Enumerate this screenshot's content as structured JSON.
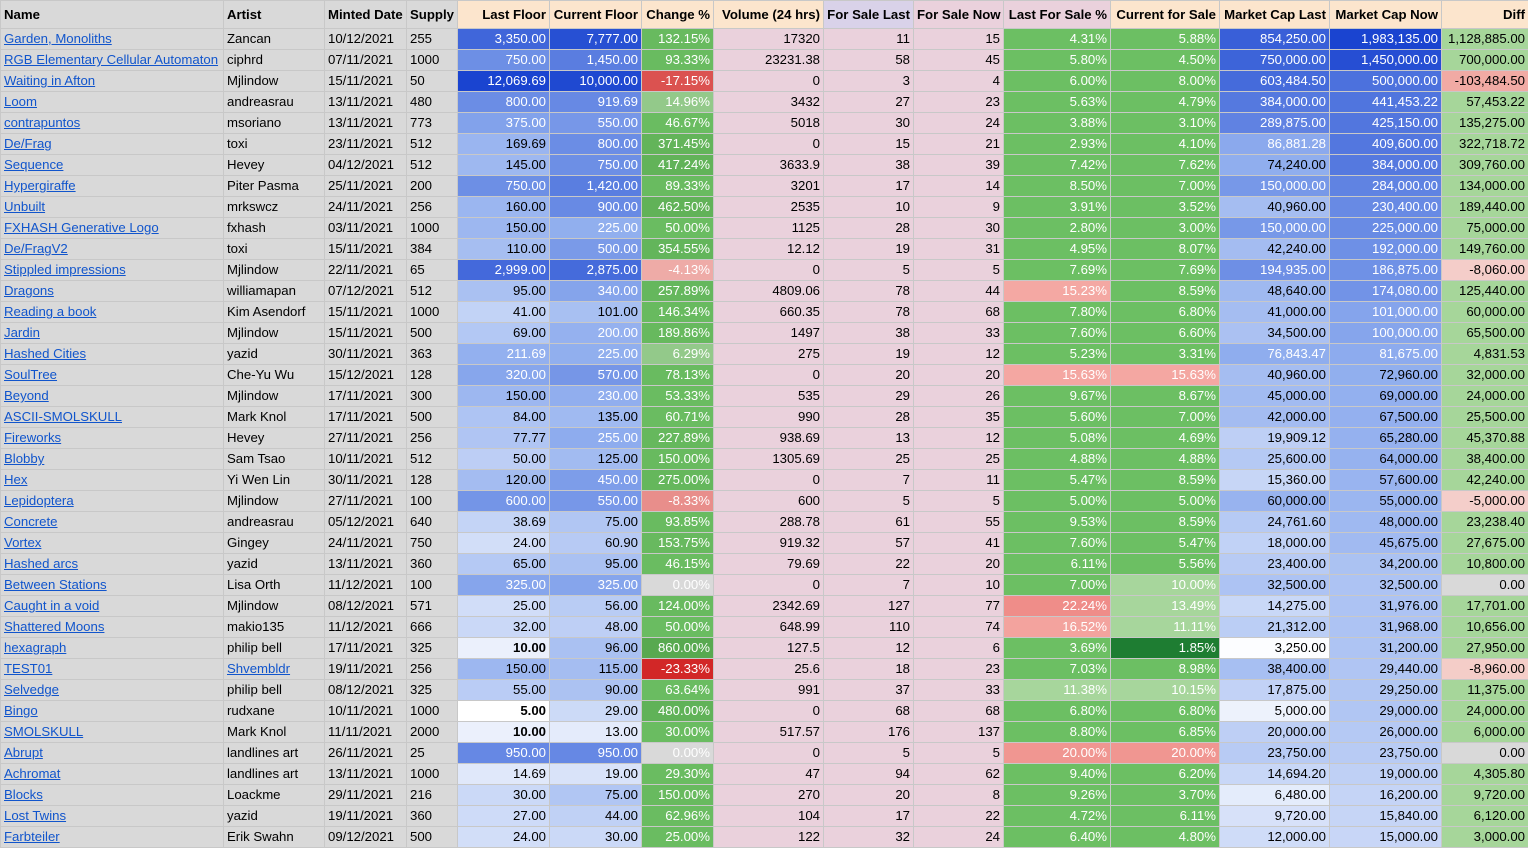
{
  "headers": [
    {
      "label": "Name",
      "cls": "h-gray",
      "align": "left",
      "name": "header-name"
    },
    {
      "label": "Artist",
      "cls": "h-gray",
      "align": "left",
      "name": "header-artist"
    },
    {
      "label": "Minted Date",
      "cls": "h-gray",
      "align": "left",
      "name": "header-minted-date"
    },
    {
      "label": "Supply",
      "cls": "h-gray",
      "align": "left",
      "name": "header-supply"
    },
    {
      "label": "Last Floor",
      "cls": "h-orange",
      "align": "right",
      "name": "header-last-floor"
    },
    {
      "label": "Current Floor",
      "cls": "h-orange",
      "align": "right",
      "name": "header-current-floor"
    },
    {
      "label": "Change %",
      "cls": "h-orange",
      "align": "right",
      "name": "header-change-pct"
    },
    {
      "label": "Volume (24 hrs)",
      "cls": "h-orange",
      "align": "right",
      "name": "header-volume"
    },
    {
      "label": "For Sale Last",
      "cls": "h-purple",
      "align": "right",
      "name": "header-for-sale-last"
    },
    {
      "label": "For Sale Now",
      "cls": "h-pink",
      "align": "right",
      "name": "header-for-sale-now"
    },
    {
      "label": "Last For Sale %",
      "cls": "h-pink",
      "align": "right",
      "name": "header-last-for-sale-pct"
    },
    {
      "label": "Current for Sale",
      "cls": "h-orange",
      "align": "right",
      "name": "header-current-for-sale"
    },
    {
      "label": "Market Cap Last",
      "cls": "h-orange",
      "align": "right",
      "name": "header-market-cap-last"
    },
    {
      "label": "Market Cap Now",
      "cls": "h-orange",
      "align": "right",
      "name": "header-market-cap-now"
    },
    {
      "label": "Diff",
      "cls": "h-orange",
      "align": "right",
      "name": "header-diff"
    }
  ],
  "colors": {
    "blue_dark": "#1c4fd6",
    "blue_mid": "#5b84e6",
    "blue_light": "#a8c0f2",
    "blue_pale": "#cfdcf8",
    "green_dark": "#1e7d32",
    "green_mid": "#57bb60",
    "green_light": "#a7d69c",
    "red_dark": "#d01c1c",
    "red_light": "#f4c7c3",
    "red_mid": "#ee8f8b",
    "pink": "#ead1dc",
    "gray": "#d9d9d9",
    "white": "#ffffff"
  },
  "rows": [
    {
      "name": "Garden, Monoliths",
      "artist": "Zancan",
      "minted": "10/12/2021",
      "supply": "255",
      "last_floor": "3,350.00",
      "current_floor": "7,777.00",
      "change": "132.15%",
      "volume": "17320",
      "fs_last": "11",
      "fs_now": "15",
      "last_fs_pct": "4.31%",
      "cur_fs": "5.88%",
      "mc_last": "854,250.00",
      "mc_now": "1,983,135.00",
      "diff": "1,128,885.00"
    },
    {
      "name": "RGB Elementary Cellular Automaton",
      "artist": "ciphrd",
      "minted": "07/11/2021",
      "supply": "1000",
      "last_floor": "750.00",
      "current_floor": "1,450.00",
      "change": "93.33%",
      "volume": "23231.38",
      "fs_last": "58",
      "fs_now": "45",
      "last_fs_pct": "5.80%",
      "cur_fs": "4.50%",
      "mc_last": "750,000.00",
      "mc_now": "1,450,000.00",
      "diff": "700,000.00"
    },
    {
      "name": "Waiting in Afton",
      "artist": "Mjlindow",
      "minted": "15/11/2021",
      "supply": "50",
      "last_floor": "12,069.69",
      "current_floor": "10,000.00",
      "change": "-17.15%",
      "volume": "0",
      "fs_last": "3",
      "fs_now": "4",
      "last_fs_pct": "6.00%",
      "cur_fs": "8.00%",
      "mc_last": "603,484.50",
      "mc_now": "500,000.00",
      "diff": "-103,484.50"
    },
    {
      "name": "Loom",
      "artist": "andreasrau",
      "minted": "13/11/2021",
      "supply": "480",
      "last_floor": "800.00",
      "current_floor": "919.69",
      "change": "14.96%",
      "volume": "3432",
      "fs_last": "27",
      "fs_now": "23",
      "last_fs_pct": "5.63%",
      "cur_fs": "4.79%",
      "mc_last": "384,000.00",
      "mc_now": "441,453.22",
      "diff": "57,453.22"
    },
    {
      "name": "contrapuntos",
      "artist": "msoriano",
      "minted": "13/11/2021",
      "supply": "773",
      "last_floor": "375.00",
      "current_floor": "550.00",
      "change": "46.67%",
      "volume": "5018",
      "fs_last": "30",
      "fs_now": "24",
      "last_fs_pct": "3.88%",
      "cur_fs": "3.10%",
      "mc_last": "289,875.00",
      "mc_now": "425,150.00",
      "diff": "135,275.00"
    },
    {
      "name": "De/Frag",
      "artist": "toxi",
      "minted": "23/11/2021",
      "supply": "512",
      "last_floor": "169.69",
      "current_floor": "800.00",
      "change": "371.45%",
      "volume": "0",
      "fs_last": "15",
      "fs_now": "21",
      "last_fs_pct": "2.93%",
      "cur_fs": "4.10%",
      "mc_last": "86,881.28",
      "mc_now": "409,600.00",
      "diff": "322,718.72"
    },
    {
      "name": "Sequence",
      "artist": "Hevey",
      "minted": "04/12/2021",
      "supply": "512",
      "last_floor": "145.00",
      "current_floor": "750.00",
      "change": "417.24%",
      "volume": "3633.9",
      "fs_last": "38",
      "fs_now": "39",
      "last_fs_pct": "7.42%",
      "cur_fs": "7.62%",
      "mc_last": "74,240.00",
      "mc_now": "384,000.00",
      "diff": "309,760.00"
    },
    {
      "name": "Hypergiraffe",
      "artist": "Piter Pasma",
      "minted": "25/11/2021",
      "supply": "200",
      "last_floor": "750.00",
      "current_floor": "1,420.00",
      "change": "89.33%",
      "volume": "3201",
      "fs_last": "17",
      "fs_now": "14",
      "last_fs_pct": "8.50%",
      "cur_fs": "7.00%",
      "mc_last": "150,000.00",
      "mc_now": "284,000.00",
      "diff": "134,000.00"
    },
    {
      "name": "Unbuilt",
      "artist": "mrkswcz",
      "minted": "24/11/2021",
      "supply": "256",
      "last_floor": "160.00",
      "current_floor": "900.00",
      "change": "462.50%",
      "volume": "2535",
      "fs_last": "10",
      "fs_now": "9",
      "last_fs_pct": "3.91%",
      "cur_fs": "3.52%",
      "mc_last": "40,960.00",
      "mc_now": "230,400.00",
      "diff": "189,440.00"
    },
    {
      "name": "FXHASH Generative Logo",
      "artist": "fxhash",
      "minted": "03/11/2021",
      "supply": "1000",
      "last_floor": "150.00",
      "current_floor": "225.00",
      "change": "50.00%",
      "volume": "1125",
      "fs_last": "28",
      "fs_now": "30",
      "last_fs_pct": "2.80%",
      "cur_fs": "3.00%",
      "mc_last": "150,000.00",
      "mc_now": "225,000.00",
      "diff": "75,000.00"
    },
    {
      "name": "De/FragV2",
      "artist": "toxi",
      "minted": "15/11/2021",
      "supply": "384",
      "last_floor": "110.00",
      "current_floor": "500.00",
      "change": "354.55%",
      "volume": "12.12",
      "fs_last": "19",
      "fs_now": "31",
      "last_fs_pct": "4.95%",
      "cur_fs": "8.07%",
      "mc_last": "42,240.00",
      "mc_now": "192,000.00",
      "diff": "149,760.00"
    },
    {
      "name": "Stippled impressions",
      "artist": "Mjlindow",
      "minted": "22/11/2021",
      "supply": "65",
      "last_floor": "2,999.00",
      "current_floor": "2,875.00",
      "change": "-4.13%",
      "volume": "0",
      "fs_last": "5",
      "fs_now": "5",
      "last_fs_pct": "7.69%",
      "cur_fs": "7.69%",
      "mc_last": "194,935.00",
      "mc_now": "186,875.00",
      "diff": "-8,060.00"
    },
    {
      "name": "Dragons",
      "artist": "williamapan",
      "minted": "07/12/2021",
      "supply": "512",
      "last_floor": "95.00",
      "current_floor": "340.00",
      "change": "257.89%",
      "volume": "4809.06",
      "fs_last": "78",
      "fs_now": "44",
      "last_fs_pct": "15.23%",
      "cur_fs": "8.59%",
      "mc_last": "48,640.00",
      "mc_now": "174,080.00",
      "diff": "125,440.00"
    },
    {
      "name": "Reading a book",
      "artist": "Kim Asendorf",
      "minted": "15/11/2021",
      "supply": "1000",
      "last_floor": "41.00",
      "current_floor": "101.00",
      "change": "146.34%",
      "volume": "660.35",
      "fs_last": "78",
      "fs_now": "68",
      "last_fs_pct": "7.80%",
      "cur_fs": "6.80%",
      "mc_last": "41,000.00",
      "mc_now": "101,000.00",
      "diff": "60,000.00"
    },
    {
      "name": "Jardin",
      "artist": "Mjlindow",
      "minted": "15/11/2021",
      "supply": "500",
      "last_floor": "69.00",
      "current_floor": "200.00",
      "change": "189.86%",
      "volume": "1497",
      "fs_last": "38",
      "fs_now": "33",
      "last_fs_pct": "7.60%",
      "cur_fs": "6.60%",
      "mc_last": "34,500.00",
      "mc_now": "100,000.00",
      "diff": "65,500.00"
    },
    {
      "name": "Hashed Cities",
      "artist": "yazid",
      "minted": "30/11/2021",
      "supply": "363",
      "last_floor": "211.69",
      "current_floor": "225.00",
      "change": "6.29%",
      "volume": "275",
      "fs_last": "19",
      "fs_now": "12",
      "last_fs_pct": "5.23%",
      "cur_fs": "3.31%",
      "mc_last": "76,843.47",
      "mc_now": "81,675.00",
      "diff": "4,831.53"
    },
    {
      "name": "SoulTree",
      "artist": "Che-Yu Wu",
      "minted": "15/12/2021",
      "supply": "128",
      "last_floor": "320.00",
      "current_floor": "570.00",
      "change": "78.13%",
      "volume": "0",
      "fs_last": "20",
      "fs_now": "20",
      "last_fs_pct": "15.63%",
      "cur_fs": "15.63%",
      "mc_last": "40,960.00",
      "mc_now": "72,960.00",
      "diff": "32,000.00"
    },
    {
      "name": "Beyond",
      "artist": "Mjlindow",
      "minted": "17/11/2021",
      "supply": "300",
      "last_floor": "150.00",
      "current_floor": "230.00",
      "change": "53.33%",
      "volume": "535",
      "fs_last": "29",
      "fs_now": "26",
      "last_fs_pct": "9.67%",
      "cur_fs": "8.67%",
      "mc_last": "45,000.00",
      "mc_now": "69,000.00",
      "diff": "24,000.00"
    },
    {
      "name": "ASCII-SMOLSKULL",
      "artist": "Mark Knol",
      "minted": "17/11/2021",
      "supply": "500",
      "last_floor": "84.00",
      "current_floor": "135.00",
      "change": "60.71%",
      "volume": "990",
      "fs_last": "28",
      "fs_now": "35",
      "last_fs_pct": "5.60%",
      "cur_fs": "7.00%",
      "mc_last": "42,000.00",
      "mc_now": "67,500.00",
      "diff": "25,500.00"
    },
    {
      "name": "Fireworks",
      "artist": "Hevey",
      "minted": "27/11/2021",
      "supply": "256",
      "last_floor": "77.77",
      "current_floor": "255.00",
      "change": "227.89%",
      "volume": "938.69",
      "fs_last": "13",
      "fs_now": "12",
      "last_fs_pct": "5.08%",
      "cur_fs": "4.69%",
      "mc_last": "19,909.12",
      "mc_now": "65,280.00",
      "diff": "45,370.88"
    },
    {
      "name": "Blobby",
      "artist": "Sam Tsao",
      "minted": "10/11/2021",
      "supply": "512",
      "last_floor": "50.00",
      "current_floor": "125.00",
      "change": "150.00%",
      "volume": "1305.69",
      "fs_last": "25",
      "fs_now": "25",
      "last_fs_pct": "4.88%",
      "cur_fs": "4.88%",
      "mc_last": "25,600.00",
      "mc_now": "64,000.00",
      "diff": "38,400.00"
    },
    {
      "name": "Hex",
      "artist": "Yi Wen Lin",
      "minted": "30/11/2021",
      "supply": "128",
      "last_floor": "120.00",
      "current_floor": "450.00",
      "change": "275.00%",
      "volume": "0",
      "fs_last": "7",
      "fs_now": "11",
      "last_fs_pct": "5.47%",
      "cur_fs": "8.59%",
      "mc_last": "15,360.00",
      "mc_now": "57,600.00",
      "diff": "42,240.00"
    },
    {
      "name": "Lepidoptera",
      "artist": "Mjlindow",
      "minted": "27/11/2021",
      "supply": "100",
      "last_floor": "600.00",
      "current_floor": "550.00",
      "change": "-8.33%",
      "volume": "600",
      "fs_last": "5",
      "fs_now": "5",
      "last_fs_pct": "5.00%",
      "cur_fs": "5.00%",
      "mc_last": "60,000.00",
      "mc_now": "55,000.00",
      "diff": "-5,000.00"
    },
    {
      "name": "Concrete",
      "artist": "andreasrau",
      "minted": "05/12/2021",
      "supply": "640",
      "last_floor": "38.69",
      "current_floor": "75.00",
      "change": "93.85%",
      "volume": "288.78",
      "fs_last": "61",
      "fs_now": "55",
      "last_fs_pct": "9.53%",
      "cur_fs": "8.59%",
      "mc_last": "24,761.60",
      "mc_now": "48,000.00",
      "diff": "23,238.40"
    },
    {
      "name": "Vortex",
      "artist": "Gingey",
      "minted": "24/11/2021",
      "supply": "750",
      "last_floor": "24.00",
      "current_floor": "60.90",
      "change": "153.75%",
      "volume": "919.32",
      "fs_last": "57",
      "fs_now": "41",
      "last_fs_pct": "7.60%",
      "cur_fs": "5.47%",
      "mc_last": "18,000.00",
      "mc_now": "45,675.00",
      "diff": "27,675.00"
    },
    {
      "name": "Hashed arcs",
      "artist": "yazid",
      "minted": "13/11/2021",
      "supply": "360",
      "last_floor": "65.00",
      "current_floor": "95.00",
      "change": "46.15%",
      "volume": "79.69",
      "fs_last": "22",
      "fs_now": "20",
      "last_fs_pct": "6.11%",
      "cur_fs": "5.56%",
      "mc_last": "23,400.00",
      "mc_now": "34,200.00",
      "diff": "10,800.00"
    },
    {
      "name": "Between Stations",
      "artist": "Lisa Orth",
      "minted": "11/12/2021",
      "supply": "100",
      "last_floor": "325.00",
      "current_floor": "325.00",
      "change": "0.00%",
      "volume": "0",
      "fs_last": "7",
      "fs_now": "10",
      "last_fs_pct": "7.00%",
      "cur_fs": "10.00%",
      "mc_last": "32,500.00",
      "mc_now": "32,500.00",
      "diff": "0.00"
    },
    {
      "name": "Caught in a void",
      "artist": "Mjlindow",
      "minted": "08/12/2021",
      "supply": "571",
      "last_floor": "25.00",
      "current_floor": "56.00",
      "change": "124.00%",
      "volume": "2342.69",
      "fs_last": "127",
      "fs_now": "77",
      "last_fs_pct": "22.24%",
      "cur_fs": "13.49%",
      "mc_last": "14,275.00",
      "mc_now": "31,976.00",
      "diff": "17,701.00"
    },
    {
      "name": "Shattered Moons",
      "artist": "makio135",
      "minted": "11/12/2021",
      "supply": "666",
      "last_floor": "32.00",
      "current_floor": "48.00",
      "change": "50.00%",
      "volume": "648.99",
      "fs_last": "110",
      "fs_now": "74",
      "last_fs_pct": "16.52%",
      "cur_fs": "11.11%",
      "mc_last": "21,312.00",
      "mc_now": "31,968.00",
      "diff": "10,656.00"
    },
    {
      "name": "hexagraph",
      "artist": "philip bell",
      "minted": "17/11/2021",
      "supply": "325",
      "last_floor": "10.00",
      "current_floor": "96.00",
      "change": "860.00%",
      "volume": "127.5",
      "fs_last": "12",
      "fs_now": "6",
      "last_fs_pct": "3.69%",
      "cur_fs": "1.85%",
      "mc_last": "3,250.00",
      "mc_now": "31,200.00",
      "diff": "27,950.00"
    },
    {
      "name": "TEST01",
      "artist": "Shvembldr",
      "minted": "19/11/2021",
      "supply": "256",
      "last_floor": "150.00",
      "current_floor": "115.00",
      "change": "-23.33%",
      "volume": "25.6",
      "fs_last": "18",
      "fs_now": "23",
      "last_fs_pct": "7.03%",
      "cur_fs": "8.98%",
      "mc_last": "38,400.00",
      "mc_now": "29,440.00",
      "diff": "-8,960.00"
    },
    {
      "name": "Selvedge",
      "artist": "philip bell",
      "minted": "08/12/2021",
      "supply": "325",
      "last_floor": "55.00",
      "current_floor": "90.00",
      "change": "63.64%",
      "volume": "991",
      "fs_last": "37",
      "fs_now": "33",
      "last_fs_pct": "11.38%",
      "cur_fs": "10.15%",
      "mc_last": "17,875.00",
      "mc_now": "29,250.00",
      "diff": "11,375.00"
    },
    {
      "name": "Bingo",
      "artist": "rudxane",
      "minted": "10/11/2021",
      "supply": "1000",
      "last_floor": "5.00",
      "current_floor": "29.00",
      "change": "480.00%",
      "volume": "0",
      "fs_last": "68",
      "fs_now": "68",
      "last_fs_pct": "6.80%",
      "cur_fs": "6.80%",
      "mc_last": "5,000.00",
      "mc_now": "29,000.00",
      "diff": "24,000.00"
    },
    {
      "name": "SMOLSKULL",
      "artist": "Mark Knol",
      "minted": "11/11/2021",
      "supply": "2000",
      "last_floor": "10.00",
      "current_floor": "13.00",
      "change": "30.00%",
      "volume": "517.57",
      "fs_last": "176",
      "fs_now": "137",
      "last_fs_pct": "8.80%",
      "cur_fs": "6.85%",
      "mc_last": "20,000.00",
      "mc_now": "26,000.00",
      "diff": "6,000.00"
    },
    {
      "name": "Abrupt",
      "artist": "landlines art",
      "minted": "26/11/2021",
      "supply": "25",
      "last_floor": "950.00",
      "current_floor": "950.00",
      "change": "0.00%",
      "volume": "0",
      "fs_last": "5",
      "fs_now": "5",
      "last_fs_pct": "20.00%",
      "cur_fs": "20.00%",
      "mc_last": "23,750.00",
      "mc_now": "23,750.00",
      "diff": "0.00"
    },
    {
      "name": "Achromat",
      "artist": "landlines art",
      "minted": "13/11/2021",
      "supply": "1000",
      "last_floor": "14.69",
      "current_floor": "19.00",
      "change": "29.30%",
      "volume": "47",
      "fs_last": "94",
      "fs_now": "62",
      "last_fs_pct": "9.40%",
      "cur_fs": "6.20%",
      "mc_last": "14,694.20",
      "mc_now": "19,000.00",
      "diff": "4,305.80"
    },
    {
      "name": "Blocks",
      "artist": "Loackme",
      "minted": "29/11/2021",
      "supply": "216",
      "last_floor": "30.00",
      "current_floor": "75.00",
      "change": "150.00%",
      "volume": "270",
      "fs_last": "20",
      "fs_now": "8",
      "last_fs_pct": "9.26%",
      "cur_fs": "3.70%",
      "mc_last": "6,480.00",
      "mc_now": "16,200.00",
      "diff": "9,720.00"
    },
    {
      "name": "Lost Twins",
      "artist": "yazid",
      "minted": "19/11/2021",
      "supply": "360",
      "last_floor": "27.00",
      "current_floor": "44.00",
      "change": "62.96%",
      "volume": "104",
      "fs_last": "17",
      "fs_now": "22",
      "last_fs_pct": "4.72%",
      "cur_fs": "6.11%",
      "mc_last": "9,720.00",
      "mc_now": "15,840.00",
      "diff": "6,120.00"
    },
    {
      "name": "Farbteiler",
      "artist": "Erik Swahn",
      "minted": "09/12/2021",
      "supply": "500",
      "last_floor": "24.00",
      "current_floor": "30.00",
      "change": "25.00%",
      "volume": "122",
      "fs_last": "32",
      "fs_now": "24",
      "last_fs_pct": "6.40%",
      "cur_fs": "4.80%",
      "mc_last": "12,000.00",
      "mc_now": "15,000.00",
      "diff": "3,000.00"
    }
  ]
}
